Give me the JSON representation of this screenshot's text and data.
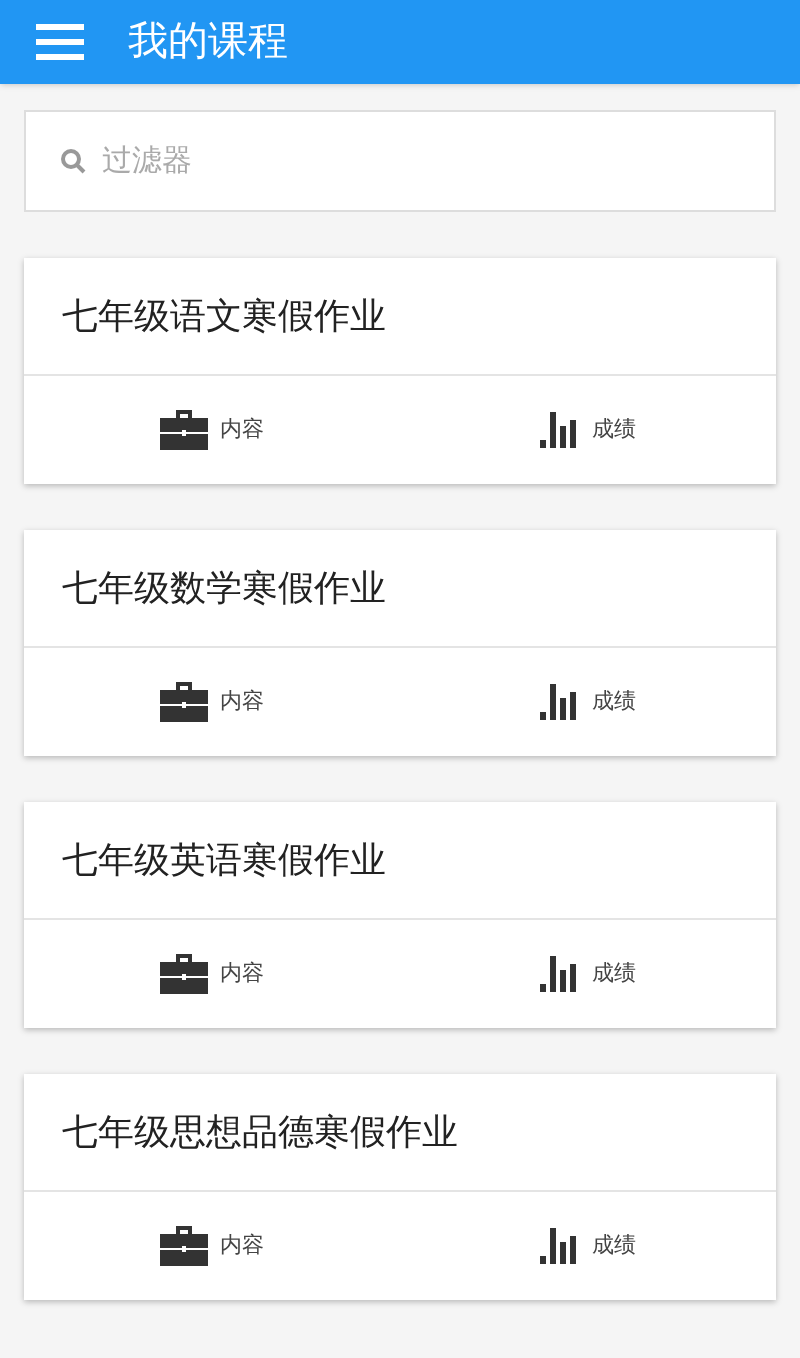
{
  "app_bar": {
    "title": "我的课程"
  },
  "search": {
    "placeholder": "过滤器"
  },
  "courses": [
    {
      "title": "七年级语文寒假作业",
      "actions": [
        "内容",
        "成绩"
      ]
    },
    {
      "title": "七年级数学寒假作业",
      "actions": [
        "内容",
        "成绩"
      ]
    },
    {
      "title": "七年级英语寒假作业",
      "actions": [
        "内容",
        "成绩"
      ]
    },
    {
      "title": "七年级思想品德寒假作业",
      "actions": [
        "内容",
        "成绩"
      ]
    }
  ]
}
